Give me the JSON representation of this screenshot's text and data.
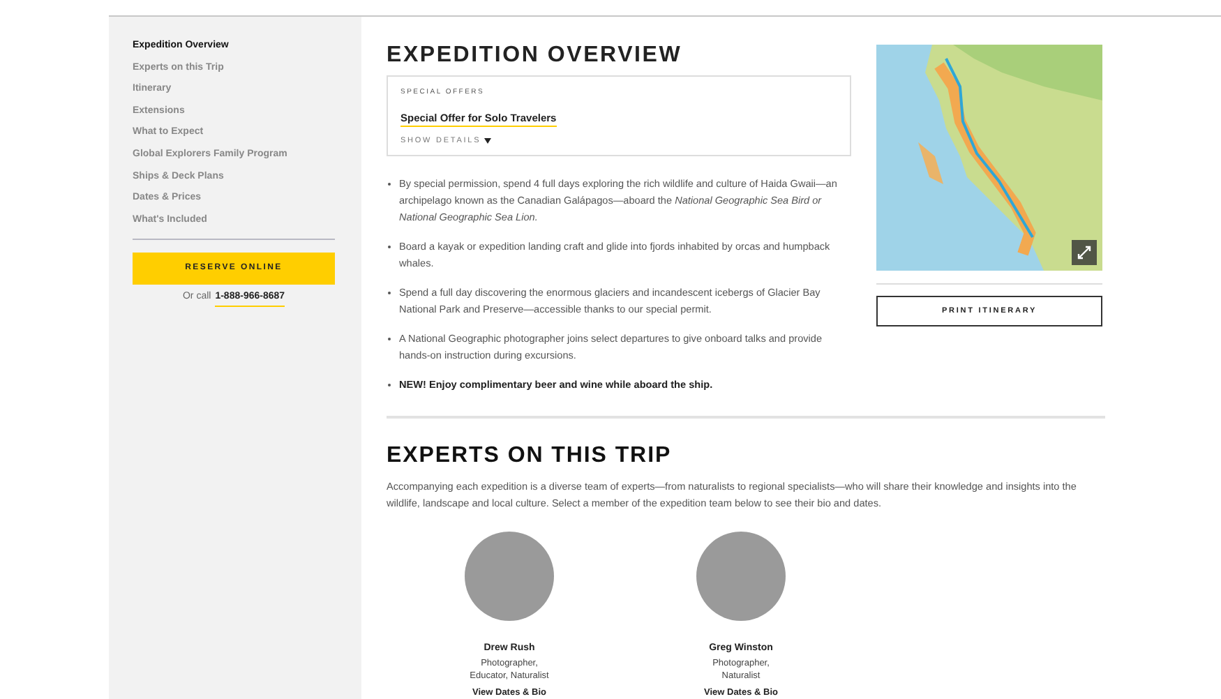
{
  "sidebar": {
    "items": [
      {
        "label": "Expedition Overview",
        "selected": true
      },
      {
        "label": "Experts on this Trip",
        "selected": false
      },
      {
        "label": "Itinerary",
        "selected": false
      },
      {
        "label": "Extensions",
        "selected": false
      },
      {
        "label": "What to Expect",
        "selected": false
      },
      {
        "label": "Global Explorers Family Program",
        "selected": false
      },
      {
        "label": "Ships & Deck Plans",
        "selected": false
      },
      {
        "label": "Dates & Prices",
        "selected": false
      },
      {
        "label": "What's Included",
        "selected": false
      }
    ],
    "reserve_button": "RESERVE ONLINE",
    "call_prefix": "Or call",
    "phone": "1-888-966-8687"
  },
  "overview": {
    "title": "EXPEDITION OVERVIEW",
    "offer": {
      "label": "SPECIAL OFFERS",
      "link": "Special Offer for Solo Travelers",
      "toggle": "SHOW DETAILS",
      "expanded": false
    },
    "bullets": [
      {
        "text": "By special permission, spend 4 full days exploring the rich wildlife and culture of Haida Gwaii—an archipelago known as the Canadian Galápagos—aboard the *National Geographic Sea Bird or National Geographic Sea Lion.*",
        "bold": false
      },
      {
        "text": "Board a kayak or expedition landing craft and glide into fjords inhabited by orcas and humpback whales.",
        "bold": false
      },
      {
        "text": "Spend a full day discovering the enormous glaciers and incandescent icebergs of Glacier Bay National Park and Preserve—accessible thanks to our special permit.",
        "bold": false
      },
      {
        "text": "A National Geographic photographer joins select departures to give onboard talks and provide hands-on instruction during excursions.",
        "bold": false
      },
      {
        "text": "NEW! Enjoy complimentary beer and wine while aboard the ship.",
        "bold": true
      }
    ],
    "print_button": "PRINT ITINERARY"
  },
  "experts": {
    "title": "EXPERTS ON THIS TRIP",
    "intro": "Accompanying each expedition is a diverse team of experts—from naturalists to regional specialists—who will share their knowledge and insights into the wildlife, landscape and local culture. Select a member of the expedition team below to see their bio and dates.",
    "people": [
      {
        "name": "Drew Rush",
        "role": "Photographer, Educator, Naturalist",
        "link": "View Dates & Bio"
      },
      {
        "name": "Greg Winston",
        "role": "Photographer, Naturalist",
        "link": "View Dates & Bio"
      }
    ]
  }
}
